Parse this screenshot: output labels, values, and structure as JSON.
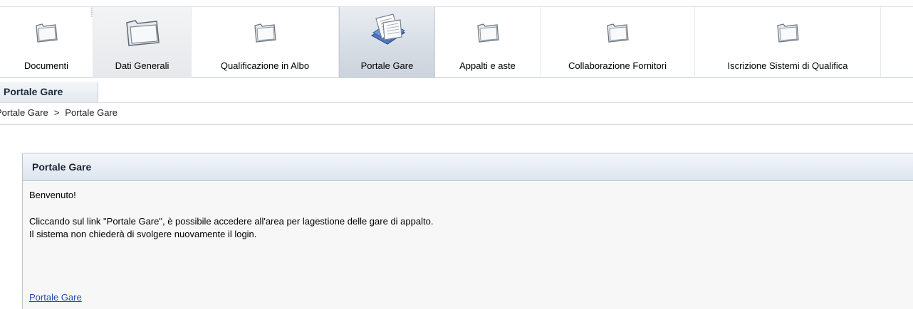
{
  "nav": {
    "tabs": [
      {
        "label": "Documenti",
        "icon": "folder-icon"
      },
      {
        "label": "Dati Generali",
        "icon": "folder-icon"
      },
      {
        "label": "Qualificazione in Albo",
        "icon": "folder-icon"
      },
      {
        "label": "Portale Gare",
        "icon": "documents-icon",
        "active": true
      },
      {
        "label": "Appalti e aste",
        "icon": "folder-icon"
      },
      {
        "label": "Collaborazione Fornitori",
        "icon": "folder-icon"
      },
      {
        "label": "Iscrizione Sistemi di Qualifica",
        "icon": "folder-icon"
      }
    ]
  },
  "subnav": {
    "active_tab": "Portale Gare"
  },
  "breadcrumb": {
    "items": [
      "Portale Gare",
      "Portale Gare"
    ],
    "separator": ">"
  },
  "panel": {
    "title": "Portale Gare",
    "welcome": "Benvenuto!",
    "line1": "Cliccando sul link \"Portale Gare\", è possibile accedere all'area per lagestione delle gare di appalto.",
    "line2": "Il sistema non chiederà di svolgere nuovamente il login.",
    "link_label": "Portale Gare"
  },
  "colors": {
    "link": "#1f4fa8",
    "panel_header": "#dde5ee",
    "active_tab": "#d7dde5"
  }
}
